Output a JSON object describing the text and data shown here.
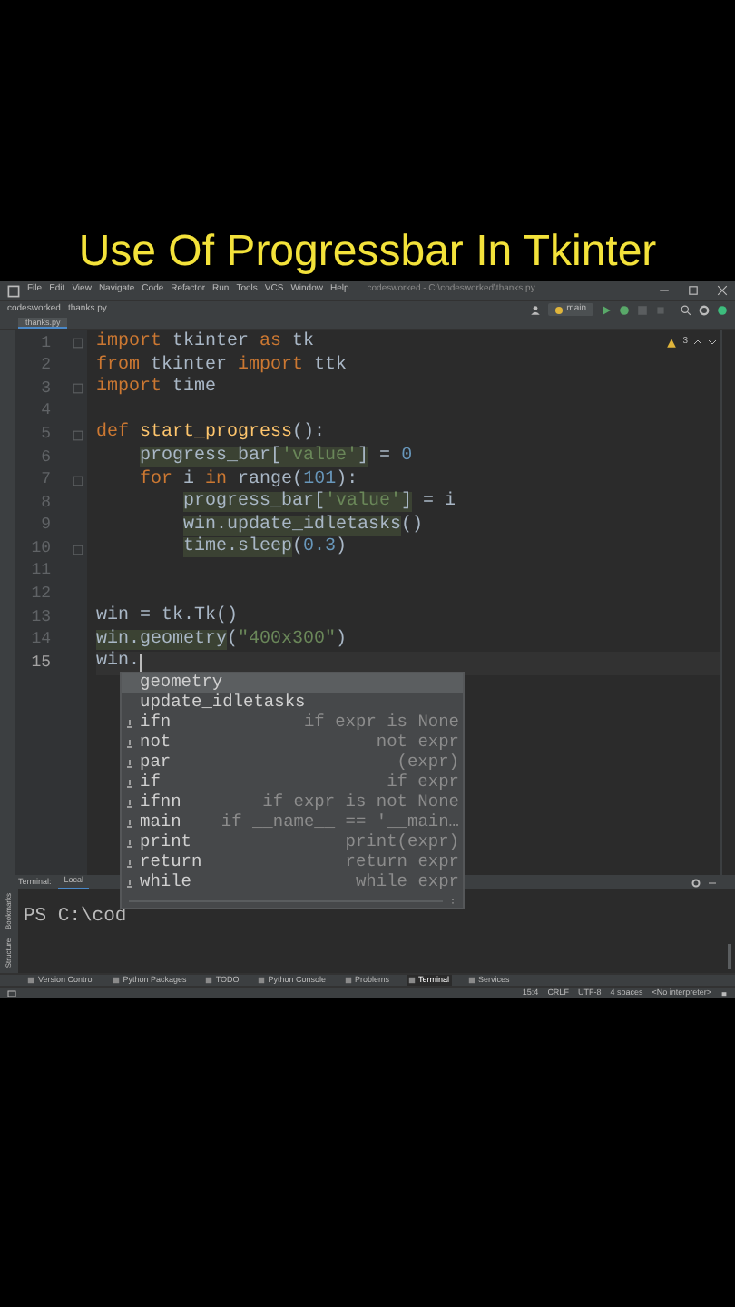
{
  "heading": "Use Of Progressbar In Tkinter",
  "menu": [
    "File",
    "Edit",
    "View",
    "Navigate",
    "Code",
    "Refactor",
    "Run",
    "Tools",
    "VCS",
    "Window",
    "Help"
  ],
  "window_title": "codesworked - C:\\codesworked\\thanks.py",
  "breadcrumbs": [
    "codesworked",
    "thanks.py"
  ],
  "run_config": "main",
  "tabs": [
    {
      "label": "thanks.py",
      "selected": true
    }
  ],
  "inspection": {
    "count": "3"
  },
  "lines": [
    {
      "number": "1",
      "fold": true,
      "current": false,
      "tokens": [
        {
          "text": "import",
          "kind": "keyword"
        },
        {
          "text": " tkinter ",
          "kind": "plain"
        },
        {
          "text": "as",
          "kind": "keyword"
        },
        {
          "text": " tk",
          "kind": "plain"
        }
      ]
    },
    {
      "number": "2",
      "fold": false,
      "current": false,
      "tokens": [
        {
          "text": "from",
          "kind": "keyword"
        },
        {
          "text": " tkinter ",
          "kind": "plain"
        },
        {
          "text": "import",
          "kind": "keyword"
        },
        {
          "text": " ttk",
          "kind": "plain"
        }
      ]
    },
    {
      "number": "3",
      "fold": true,
      "current": false,
      "tokens": [
        {
          "text": "import",
          "kind": "keyword"
        },
        {
          "text": " time",
          "kind": "plain"
        }
      ]
    },
    {
      "number": "4",
      "fold": false,
      "current": false
    },
    {
      "number": "5",
      "fold": true,
      "current": false,
      "tokens": [
        {
          "text": "def",
          "kind": "keyword"
        },
        {
          "text": " start_progress",
          "kind": "function"
        },
        {
          "text": "():",
          "kind": "plain"
        }
      ],
      "children": [
        {
          "number": "6",
          "fold": false,
          "current": false,
          "tokens": [
            {
              "text": "progress_bar[",
              "kind": "usage"
            },
            {
              "text": "'value'",
              "kind": "usage_string"
            },
            {
              "text": "]",
              "kind": "usage"
            },
            {
              "text": " = ",
              "kind": "plain"
            },
            {
              "text": "0",
              "kind": "number"
            }
          ]
        },
        {
          "number": "7",
          "fold": true,
          "current": false,
          "tokens": [
            {
              "text": "for",
              "kind": "keyword"
            },
            {
              "text": " i ",
              "kind": "plain"
            },
            {
              "text": "in",
              "kind": "keyword"
            },
            {
              "text": " range(",
              "kind": "plain"
            },
            {
              "text": "101",
              "kind": "number"
            },
            {
              "text": "):",
              "kind": "plain"
            }
          ],
          "children": [
            {
              "number": "8",
              "fold": false,
              "current": false,
              "tokens": [
                {
                  "text": "progress_bar[",
                  "kind": "usage"
                },
                {
                  "text": "'value'",
                  "kind": "usage_string"
                },
                {
                  "text": "]",
                  "kind": "usage"
                },
                {
                  "text": " = i",
                  "kind": "plain"
                }
              ]
            },
            {
              "number": "9",
              "fold": false,
              "current": false,
              "tokens": [
                {
                  "text": "win.update_idletasks",
                  "kind": "usage"
                },
                {
                  "text": "()",
                  "kind": "plain"
                }
              ]
            },
            {
              "number": "10",
              "fold": true,
              "current": false,
              "tokens": [
                {
                  "text": "time.sleep",
                  "kind": "usage"
                },
                {
                  "text": "(",
                  "kind": "plain"
                },
                {
                  "text": "0.3",
                  "kind": "number"
                },
                {
                  "text": ")",
                  "kind": "plain"
                }
              ]
            }
          ]
        }
      ]
    },
    {
      "number": "11",
      "fold": false,
      "current": false
    },
    {
      "number": "12",
      "fold": false,
      "current": false
    },
    {
      "number": "13",
      "fold": false,
      "current": false,
      "tokens": [
        {
          "text": "win = tk.Tk()",
          "kind": "plain"
        }
      ]
    },
    {
      "number": "14",
      "fold": false,
      "current": false,
      "tokens": [
        {
          "text": "win.geometry",
          "kind": "usage"
        },
        {
          "text": "(",
          "kind": "plain"
        },
        {
          "text": "\"400x300\"",
          "kind": "string"
        },
        {
          "text": ")",
          "kind": "plain"
        }
      ]
    },
    {
      "number": "15",
      "fold": false,
      "current": true,
      "tokens": [
        {
          "text": "win.",
          "kind": "plain"
        }
      ]
    }
  ],
  "completion": [
    {
      "name": "geometry",
      "kind": "method",
      "selected": true
    },
    {
      "name": "update_idletasks",
      "kind": "method",
      "selected": false
    },
    {
      "name": "ifn",
      "hint": "if expr is None",
      "kind": "template",
      "selected": false
    },
    {
      "name": "not",
      "hint": "not expr",
      "kind": "template",
      "selected": false
    },
    {
      "name": "par",
      "hint": "(expr)",
      "kind": "template",
      "selected": false
    },
    {
      "name": "if",
      "hint": "if expr",
      "kind": "template",
      "selected": false
    },
    {
      "name": "ifnn",
      "hint": "if expr is not None",
      "kind": "template",
      "selected": false
    },
    {
      "name": "main",
      "hint": "if __name__ == '__main…",
      "kind": "template",
      "selected": false
    },
    {
      "name": "print",
      "hint": "print(expr)",
      "kind": "template",
      "selected": false
    },
    {
      "name": "return",
      "hint": "return expr",
      "kind": "template",
      "selected": false
    },
    {
      "name": "while",
      "hint": "while expr",
      "kind": "template",
      "selected": false
    }
  ],
  "terminal": {
    "title": "Terminal:",
    "tab": "Local",
    "output": "PS C:\\cod"
  },
  "side_labels": [
    "Bookmarks",
    "Structure"
  ],
  "tool_tabs": [
    {
      "label": "Version Control",
      "selected": false
    },
    {
      "label": "Python Packages",
      "selected": false
    },
    {
      "label": "TODO",
      "selected": false
    },
    {
      "label": "Python Console",
      "selected": false
    },
    {
      "label": "Problems",
      "selected": false
    },
    {
      "label": "Terminal",
      "selected": true
    },
    {
      "label": "Services",
      "selected": false
    }
  ],
  "status": [
    "15:4",
    "CRLF",
    "UTF-8",
    "4 spaces",
    "<No interpreter>"
  ]
}
